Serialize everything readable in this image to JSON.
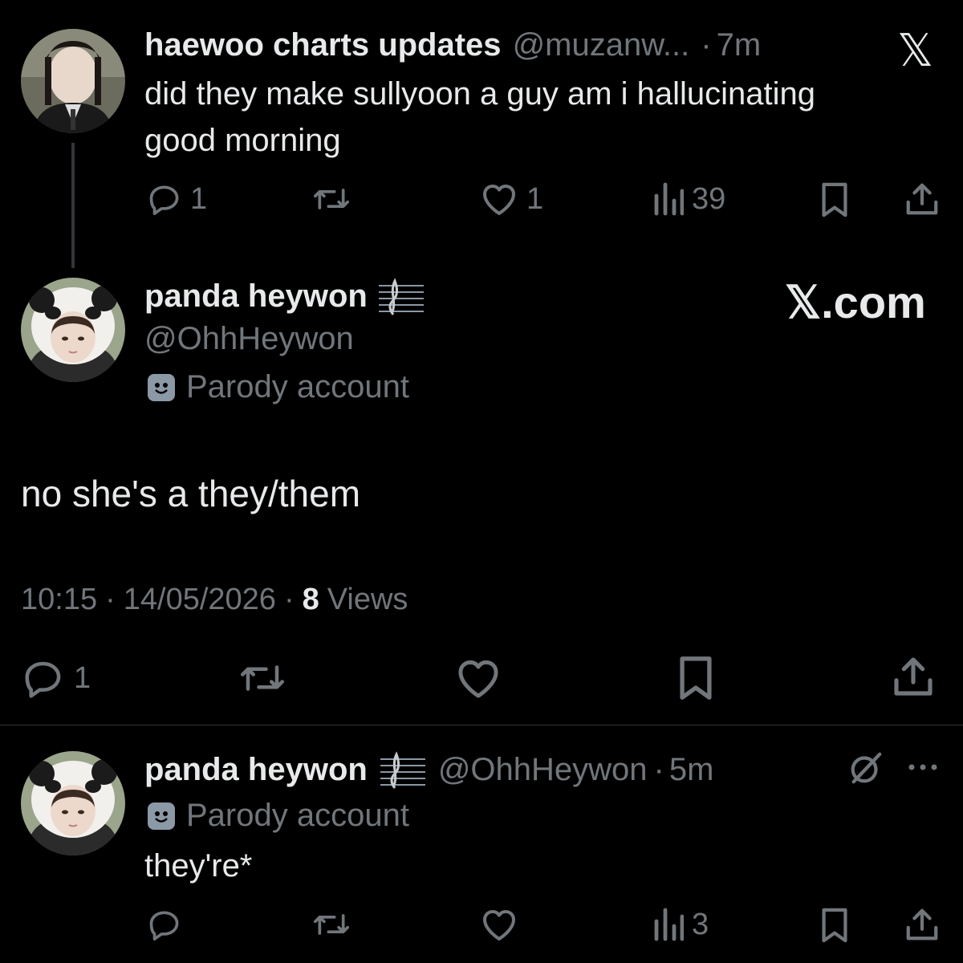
{
  "tweet1": {
    "author_name": "haewoo charts updates",
    "handle": "@muzanw...",
    "separator": "·",
    "time": "7m",
    "text_line1": "did they make sullyoon a guy am i hallucinating",
    "text_line2": "good morning",
    "reply_count": "1",
    "like_count": "1",
    "views_count": "39"
  },
  "main_tweet": {
    "author_name": "panda heywon",
    "handle": "@OhhHeywon",
    "parody_label": "Parody account",
    "text": "no she's a they/them",
    "time": "10:15",
    "separator1": "·",
    "date": "14/05/2026",
    "separator2": "·",
    "views_count": "8",
    "views_label": "Views",
    "reply_count": "1"
  },
  "tweet3": {
    "author_name": "panda heywon",
    "handle": "@OhhHeywon",
    "separator": "·",
    "time": "5m",
    "parody_label": "Parody account",
    "text": "they're*",
    "views_count": "3"
  },
  "watermark": {
    "x_logo": "𝕏",
    "site": "𝕏.com"
  },
  "colors": {
    "background": "#000000",
    "text": "#e7e9ea",
    "muted": "#71767b",
    "divider": "#2f3336"
  },
  "icons": [
    "reply-icon",
    "retweet-icon",
    "like-icon",
    "views-icon",
    "bookmark-icon",
    "share-icon",
    "grok-icon",
    "more-icon",
    "parody-mask-icon",
    "music-staff-icon"
  ]
}
